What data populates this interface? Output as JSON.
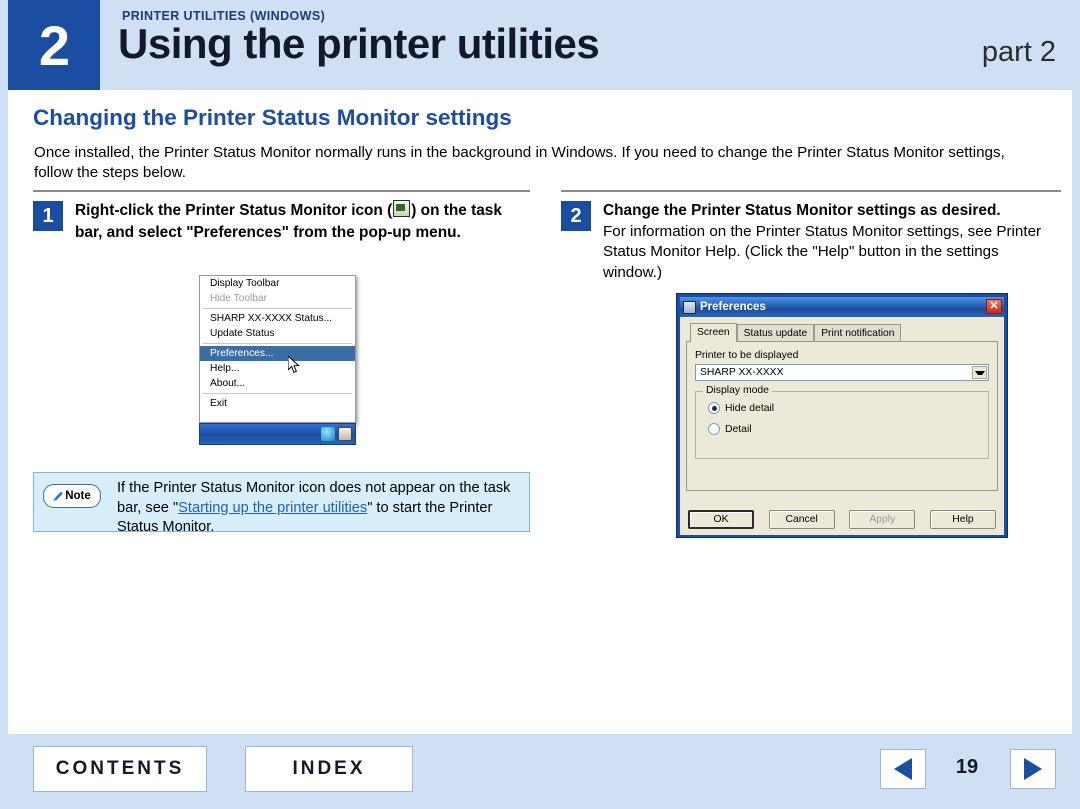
{
  "header": {
    "chapter_number": "2",
    "kicker": "PRINTER UTILITIES (WINDOWS)",
    "title": "Using the printer utilities",
    "part": "part 2"
  },
  "section": {
    "title": "Changing the Printer Status Monitor settings",
    "intro": "Once installed, the Printer Status Monitor normally runs in the background in Windows. If you need to change the Printer Status Monitor settings, follow the steps below."
  },
  "steps": [
    {
      "number": "1",
      "heading_before_icon": "Right-click the Printer Status Monitor icon (",
      "heading_after_icon": ")",
      "heading_rest": "on the task bar, and select \"Preferences\" from the pop-up menu.",
      "icon": "printer-status-monitor-icon"
    },
    {
      "number": "2",
      "heading": "Change the Printer Status Monitor settings as desired.",
      "body": "For information on the Printer Status Monitor settings, see Printer Status Monitor Help. (Click the \"Help\" button in the settings window.)"
    }
  ],
  "popup_menu": {
    "items": [
      {
        "label": "Display Toolbar",
        "state": "normal"
      },
      {
        "label": "Hide Toolbar",
        "state": "disabled"
      },
      {
        "label": "SHARP XX-XXXX Status...",
        "state": "normal"
      },
      {
        "label": "Update Status",
        "state": "normal"
      },
      {
        "label": "Preferences...",
        "state": "highlight"
      },
      {
        "label": "Help...",
        "state": "normal"
      },
      {
        "label": "About...",
        "state": "normal"
      },
      {
        "label": "Exit",
        "state": "normal"
      }
    ],
    "tray_icons": [
      "network-icon",
      "printer-status-monitor-icon"
    ],
    "cursor": "mouse-pointer"
  },
  "note": {
    "badge": "Note",
    "text_before_link": "If the Printer Status Monitor icon does not appear on the task bar, see \"",
    "link": "Starting up the printer utilities",
    "text_after_link": "\" to start the Printer Status Monitor."
  },
  "dialog": {
    "title": "Preferences",
    "close_label": "✕",
    "tabs": [
      {
        "label": "Screen",
        "active": true
      },
      {
        "label": "Status update",
        "active": false
      },
      {
        "label": "Print notification",
        "active": false
      }
    ],
    "printer_field_label": "Printer to be displayed",
    "printer_value": "SHARP XX-XXXX",
    "display_mode_legend": "Display mode",
    "radios": [
      {
        "label": "Hide detail",
        "selected": true
      },
      {
        "label": "Detail",
        "selected": false
      }
    ],
    "buttons": [
      {
        "label": "OK",
        "style": "default"
      },
      {
        "label": "Cancel",
        "style": "normal"
      },
      {
        "label": "Apply",
        "style": "disabled"
      },
      {
        "label": "Help",
        "style": "normal"
      }
    ]
  },
  "footer": {
    "contents": "CONTENTS",
    "index": "INDEX",
    "page_number": "19",
    "prev_icon": "triangle-left-icon",
    "next_icon": "triangle-right-icon"
  },
  "colors": {
    "brand_blue": "#1b4ea0",
    "header_bg": "#cfe0f5",
    "note_bg": "#d9eefb",
    "link": "#1f5fbf"
  }
}
